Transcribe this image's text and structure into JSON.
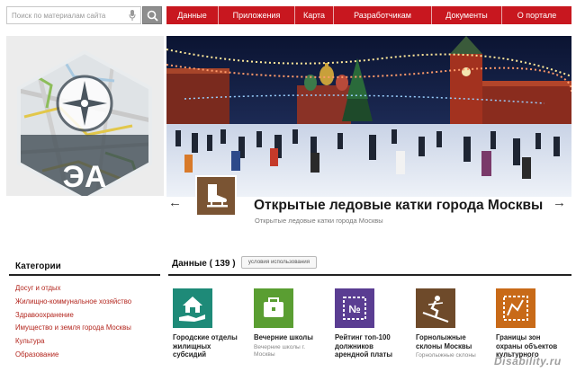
{
  "search": {
    "placeholder": "Поиск по материалам сайта"
  },
  "nav": {
    "items": [
      {
        "label": "Данные"
      },
      {
        "label": "Приложения"
      },
      {
        "label": "Карта"
      },
      {
        "label": "Разработчикам"
      },
      {
        "label": "Документы"
      },
      {
        "label": "О портале"
      }
    ]
  },
  "logo": {
    "text": "ЭА"
  },
  "hero": {
    "title": "Открытые ледовые катки города Москвы",
    "subtitle": "Открытые ледовые катки города Москвы",
    "prev_label": "←",
    "next_label": "→",
    "icon": "ice-skate-icon"
  },
  "categories": {
    "title": "Категории",
    "items": [
      "Досуг и отдых",
      "Жилищно-коммунальное хозяйство",
      "Здравоохранение",
      "Имущество и земля города Москвы",
      "Культура",
      "Образование"
    ]
  },
  "data_section": {
    "title": "Данные ( 139 )",
    "terms_label": "условия использования",
    "tiles": [
      {
        "label": "Городские отделы жилищных субсидий",
        "desc": "",
        "icon": "house-hand-icon",
        "color": "#1e8a78"
      },
      {
        "label": "Вечерние школы",
        "desc": "Вечерние школы г. Москвы",
        "icon": "briefcase-icon",
        "color": "#5a9e32"
      },
      {
        "label": "Рейтинг топ-100 должников арендной платы",
        "desc": "",
        "icon": "number-sign-icon",
        "color": "#5a3d92"
      },
      {
        "label": "Горнолыжные склоны Москвы",
        "desc": "Горнолыжные склоны",
        "icon": "skier-icon",
        "color": "#6e4a2a"
      },
      {
        "label": "Границы зон охраны объектов культурного",
        "desc": "",
        "icon": "map-boundary-icon",
        "color": "#c86a18"
      }
    ]
  },
  "watermark": "Disability.ru",
  "colors": {
    "nav_bg": "#c8171f",
    "category_link": "#b3261e"
  }
}
